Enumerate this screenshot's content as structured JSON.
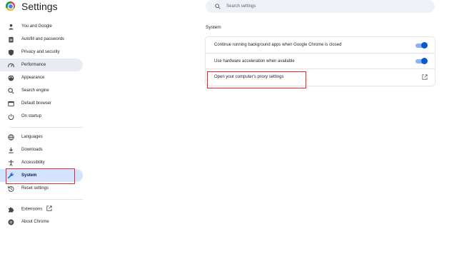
{
  "header": {
    "title": "Settings",
    "logo_icon": "chrome-logo-icon"
  },
  "search": {
    "placeholder": "Search settings",
    "icon": "search-icon"
  },
  "sidebar": {
    "items": [
      {
        "label": "You and Google",
        "icon": "person-icon"
      },
      {
        "label": "Autofill and passwords",
        "icon": "clipboard-icon"
      },
      {
        "label": "Privacy and security",
        "icon": "shield-icon"
      },
      {
        "label": "Performance",
        "icon": "speedometer-icon"
      },
      {
        "label": "Appearance",
        "icon": "palette-icon"
      },
      {
        "label": "Search engine",
        "icon": "search-icon"
      },
      {
        "label": "Default browser",
        "icon": "browser-window-icon"
      },
      {
        "label": "On startup",
        "icon": "power-icon"
      },
      {
        "label": "Languages",
        "icon": "globe-icon"
      },
      {
        "label": "Downloads",
        "icon": "download-icon"
      },
      {
        "label": "Accessibility",
        "icon": "accessibility-icon"
      },
      {
        "label": "System",
        "icon": "wrench-icon"
      },
      {
        "label": "Reset settings",
        "icon": "reset-icon"
      },
      {
        "label": "Extensions",
        "icon": "puzzle-icon"
      },
      {
        "label": "About Chrome",
        "icon": "chrome-icon"
      }
    ],
    "selected": "System",
    "hovered": "Performance"
  },
  "main": {
    "section_title": "System",
    "rows": [
      {
        "label": "Continue running background apps when Google Chrome is closed",
        "control": "toggle",
        "checked": true
      },
      {
        "label": "Use hardware acceleration when available",
        "control": "toggle",
        "checked": true
      },
      {
        "label": "Open your computer's proxy settings",
        "control": "external-link-icon"
      }
    ]
  },
  "colors": {
    "accent": "#0b57d0",
    "selected_bg": "#d3e3fd",
    "annotation_red": "#e8292c"
  }
}
